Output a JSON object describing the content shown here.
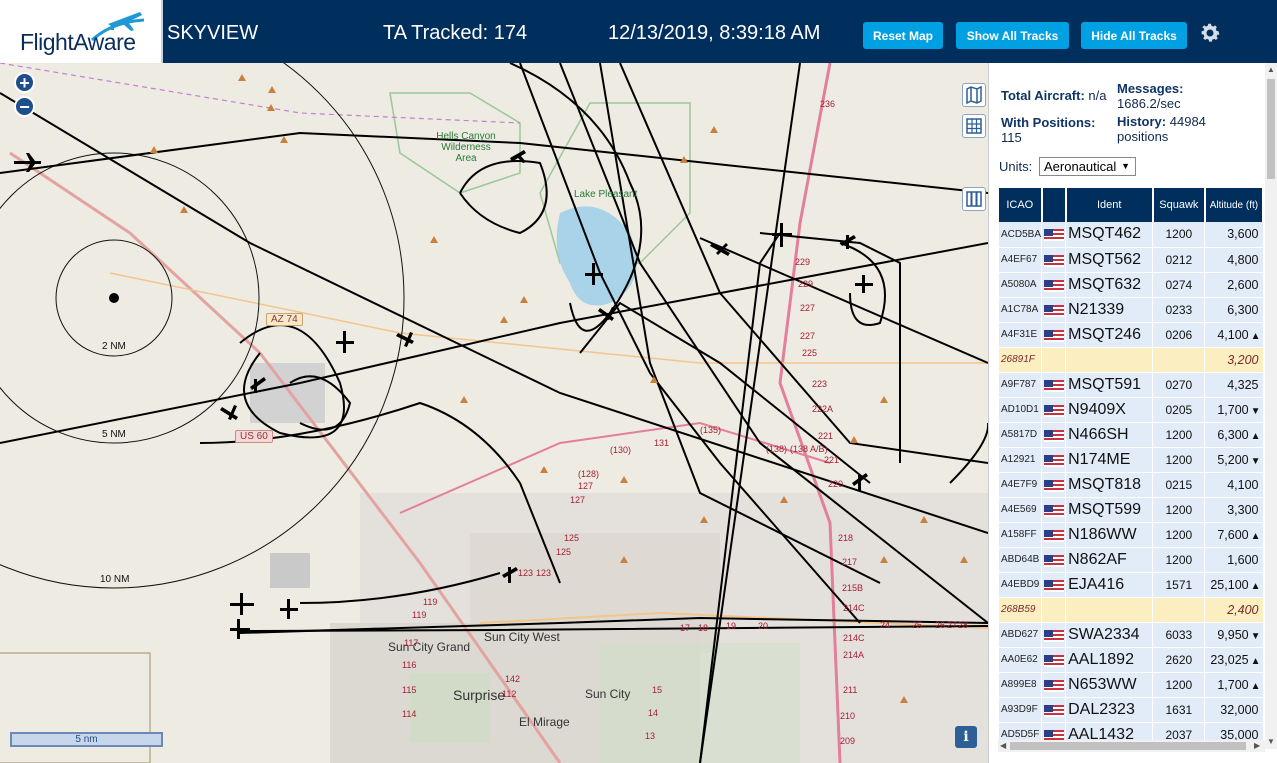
{
  "header": {
    "logo_text": "FlightAware",
    "app_name": "SKYVIEW",
    "ta_tracked": "TA Tracked: 174",
    "datetime": "12/13/2019, 8:39:18 AM",
    "buttons": {
      "reset": "Reset Map",
      "show_all": "Show All Tracks",
      "hide_all": "Hide All Tracks"
    },
    "settings_icon": "gear-icon",
    "colors": {
      "header_bg": "#002f5d",
      "button_bg": "#00a0e2"
    }
  },
  "map": {
    "zoom_in": "+",
    "zoom_out": "−",
    "info": "i",
    "scale_label": "5 nm",
    "range_rings": [
      "2 NM",
      "5 NM",
      "10 NM"
    ],
    "places": {
      "sun_city_grand": "Sun City Grand",
      "sun_city_west": "Sun City West",
      "surprise": "Surprise",
      "sun_city": "Sun City",
      "el_mirage": "El Mirage",
      "lake_pleasant": "Lake Pleasant",
      "hells_canyon": "Hells Canyon Wilderness Area"
    },
    "highways": {
      "az74": "AZ 74",
      "us60": "US 60"
    },
    "road_numbers": [
      "236",
      "229",
      "229",
      "227",
      "227",
      "225",
      "223",
      "222A",
      "221",
      "221",
      "220",
      "218",
      "217",
      "215B",
      "214C",
      "214C",
      "214A",
      "211",
      "210",
      "209",
      "131",
      "(130)",
      "(135)",
      "(138 A/B)",
      "(138)",
      "(128)",
      "127",
      "127",
      "125",
      "125",
      "123",
      "123",
      "119",
      "119",
      "117",
      "116",
      "115",
      "114",
      "112",
      "142",
      "17",
      "18",
      "19",
      "20",
      "24",
      "25",
      "26",
      "27",
      "28",
      "13",
      "14",
      "15"
    ],
    "controls": [
      "layers-icon",
      "grid-icon",
      "columns-icon"
    ]
  },
  "sidebar": {
    "total_aircraft_label": "Total Aircraft:",
    "total_aircraft_value": "n/a",
    "messages_label": "Messages:",
    "messages_value": "1686.2/sec",
    "with_positions_label": "With Positions:",
    "with_positions_value": "115",
    "history_label": "History:",
    "history_value": "44984 positions",
    "units_label": "Units:",
    "units_value": "Aeronautical",
    "columns": [
      "ICAO",
      "Ident",
      "Squawk",
      "Altitude (ft)"
    ],
    "rows": [
      {
        "icao": "ACD5BA",
        "ident": "MSQT462",
        "squawk": "1200",
        "alt": "3,600",
        "trend": ""
      },
      {
        "icao": "A4EF67",
        "ident": "MSQT562",
        "squawk": "0212",
        "alt": "4,800",
        "trend": ""
      },
      {
        "icao": "A5080A",
        "ident": "MSQT632",
        "squawk": "0274",
        "alt": "2,600",
        "trend": ""
      },
      {
        "icao": "A1C78A",
        "ident": "N21339",
        "squawk": "0233",
        "alt": "6,300",
        "trend": ""
      },
      {
        "icao": "A4F31E",
        "ident": "MSQT246",
        "squawk": "0206",
        "alt": "4,100",
        "trend": "▲"
      },
      {
        "icao": "26891F",
        "ident": "",
        "squawk": "",
        "alt": "3,200",
        "trend": "",
        "nopos": true
      },
      {
        "icao": "A9F787",
        "ident": "MSQT591",
        "squawk": "0270",
        "alt": "4,325",
        "trend": ""
      },
      {
        "icao": "AD10D1",
        "ident": "N9409X",
        "squawk": "0205",
        "alt": "1,700",
        "trend": "▼"
      },
      {
        "icao": "A5817D",
        "ident": "N466SH",
        "squawk": "1200",
        "alt": "6,300",
        "trend": "▲"
      },
      {
        "icao": "A12921",
        "ident": "N174ME",
        "squawk": "1200",
        "alt": "5,200",
        "trend": "▼"
      },
      {
        "icao": "A4E7F9",
        "ident": "MSQT818",
        "squawk": "0215",
        "alt": "4,100",
        "trend": ""
      },
      {
        "icao": "A4E569",
        "ident": "MSQT599",
        "squawk": "1200",
        "alt": "3,300",
        "trend": ""
      },
      {
        "icao": "A158FF",
        "ident": "N186WW",
        "squawk": "1200",
        "alt": "7,600",
        "trend": "▲"
      },
      {
        "icao": "ABD64B",
        "ident": "N862AF",
        "squawk": "1200",
        "alt": "1,600",
        "trend": ""
      },
      {
        "icao": "A4EBD9",
        "ident": "EJA416",
        "squawk": "1571",
        "alt": "25,100",
        "trend": "▲"
      },
      {
        "icao": "268B59",
        "ident": "",
        "squawk": "",
        "alt": "2,400",
        "trend": "",
        "nopos": true
      },
      {
        "icao": "ABD627",
        "ident": "SWA2334",
        "squawk": "6033",
        "alt": "9,950",
        "trend": "▼"
      },
      {
        "icao": "AA0E62",
        "ident": "AAL1892",
        "squawk": "2620",
        "alt": "23,025",
        "trend": "▲"
      },
      {
        "icao": "A899E8",
        "ident": "N653WW",
        "squawk": "1200",
        "alt": "1,700",
        "trend": "▲"
      },
      {
        "icao": "A93D9F",
        "ident": "DAL2323",
        "squawk": "1631",
        "alt": "32,000",
        "trend": ""
      },
      {
        "icao": "AD5D5F",
        "ident": "AAL1432",
        "squawk": "2037",
        "alt": "35,000",
        "trend": ""
      }
    ]
  }
}
